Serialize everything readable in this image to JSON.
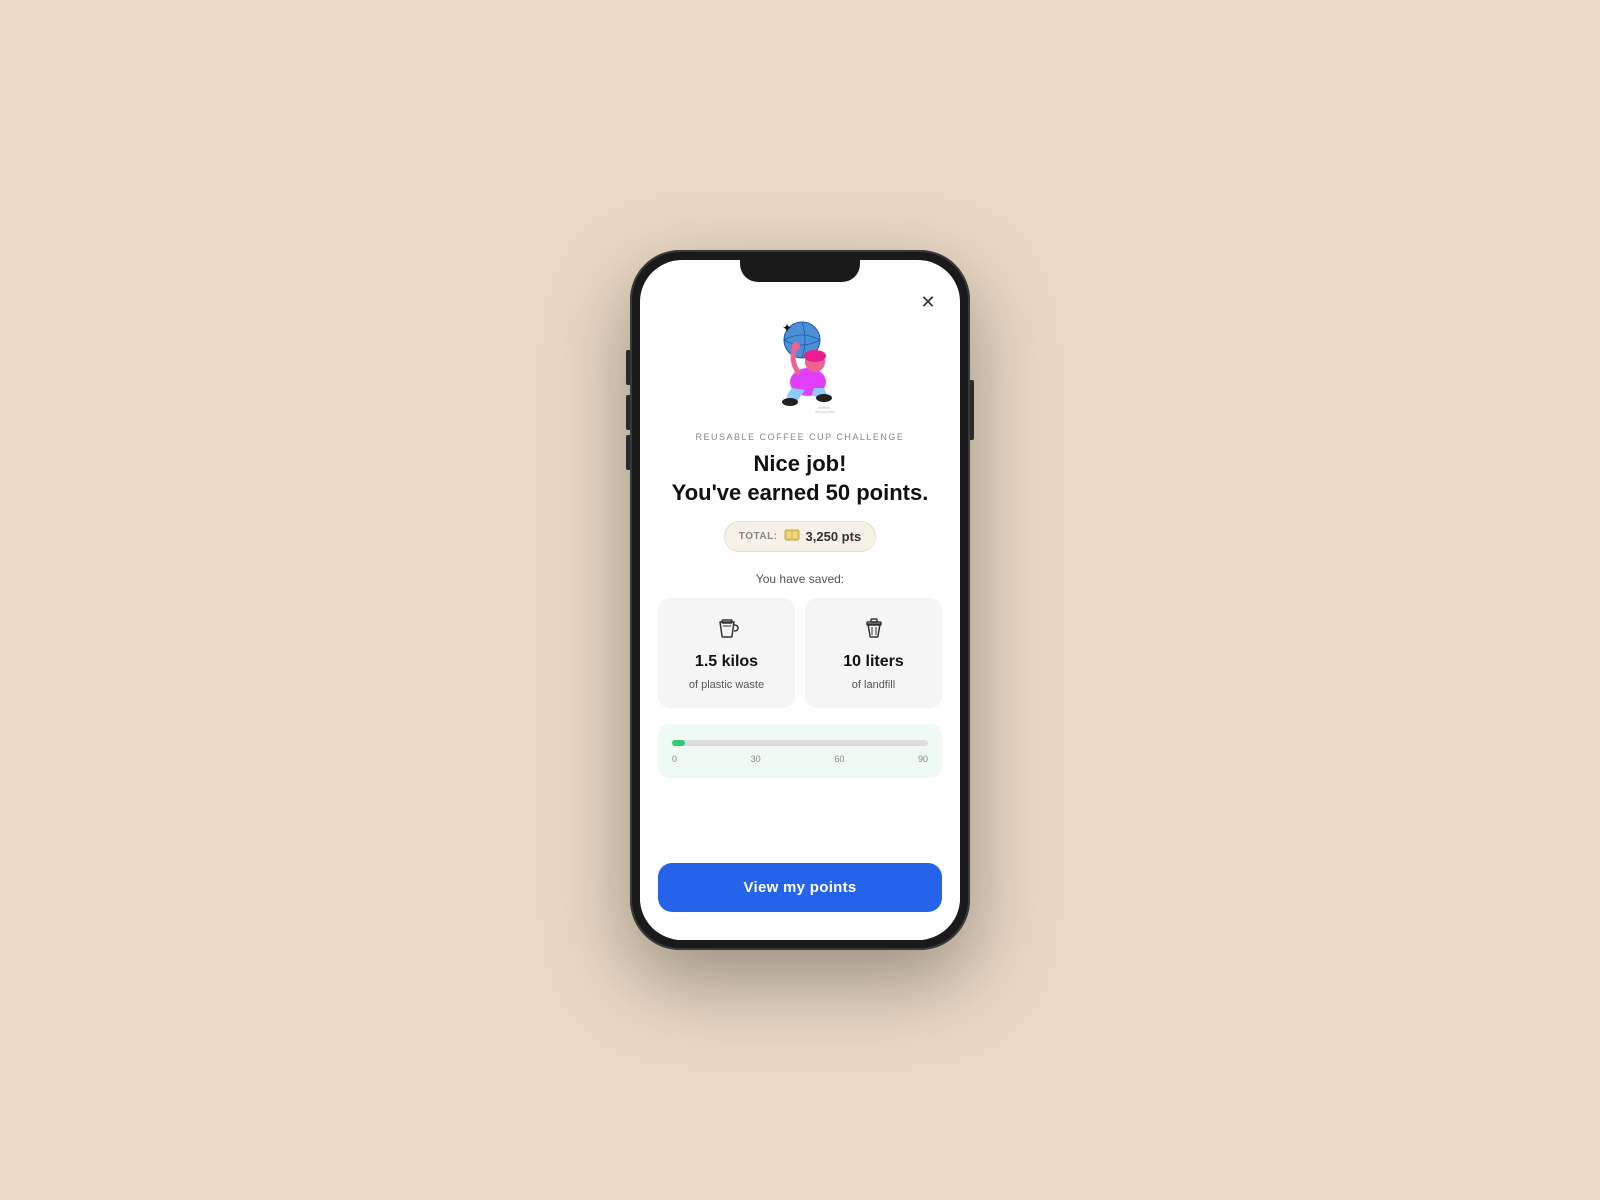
{
  "app": {
    "background_color": "#e8d9c4"
  },
  "close_button": "✕",
  "challenge": {
    "label": "REUSABLE COFFEE CUP CHALLENGE",
    "headline_line1": "Nice job!",
    "headline_line2": "You've earned 50 points."
  },
  "total": {
    "label": "TOTAL:",
    "points": "3,250 pts"
  },
  "saved_section": {
    "label": "You have saved:",
    "items": [
      {
        "amount": "1.5 kilos",
        "unit": "of plastic waste",
        "icon": "cup"
      },
      {
        "amount": "10 liters",
        "unit": "of landfill",
        "icon": "trash"
      }
    ]
  },
  "progress": {
    "ticks": [
      "0",
      "30",
      "60",
      "90"
    ],
    "fill_percent": 5
  },
  "view_button": {
    "label": "View my points"
  }
}
